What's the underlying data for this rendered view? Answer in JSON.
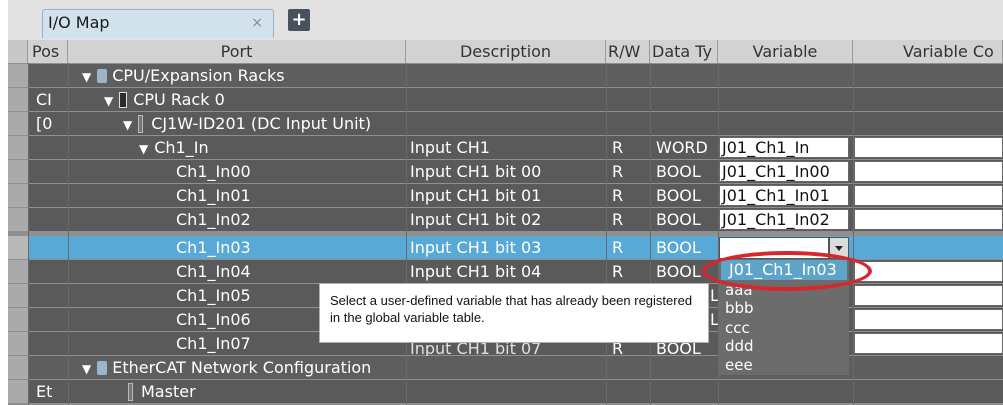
{
  "tab": {
    "title": "I/O Map",
    "close": "×",
    "add": "+"
  },
  "columns": [
    "Pos",
    "Port",
    "Description",
    "R/W",
    "Data Ty",
    "Variable",
    "Variable Co"
  ],
  "rows": [
    {
      "pos": "",
      "port": "CPU/Expansion Racks",
      "desc": "",
      "rw": "",
      "type": "",
      "var": ""
    },
    {
      "pos": "CI",
      "port": "CPU Rack 0",
      "desc": "",
      "rw": "",
      "type": "",
      "var": ""
    },
    {
      "pos": "[0",
      "port": "CJ1W-ID201 (DC Input Unit)",
      "desc": "",
      "rw": "",
      "type": "",
      "var": ""
    },
    {
      "pos": "",
      "port": "Ch1_In",
      "desc": "Input CH1",
      "rw": "R",
      "type": "WORD",
      "var": "J01_Ch1_In"
    },
    {
      "pos": "",
      "port": "Ch1_In00",
      "desc": "Input CH1 bit 00",
      "rw": "R",
      "type": "BOOL",
      "var": "J01_Ch1_In00"
    },
    {
      "pos": "",
      "port": "Ch1_In01",
      "desc": "Input CH1 bit 01",
      "rw": "R",
      "type": "BOOL",
      "var": "J01_Ch1_In01"
    },
    {
      "pos": "",
      "port": "Ch1_In02",
      "desc": "Input CH1 bit 02",
      "rw": "R",
      "type": "BOOL",
      "var": "J01_Ch1_In02"
    },
    {
      "pos": "",
      "port": "Ch1_In03",
      "desc": "Input CH1 bit 03",
      "rw": "R",
      "type": "BOOL",
      "var": ""
    },
    {
      "pos": "",
      "port": "Ch1_In04",
      "desc": "Input CH1 bit 04",
      "rw": "R",
      "type": "BOOL",
      "var": ""
    },
    {
      "pos": "",
      "port": "Ch1_In05",
      "desc": "",
      "rw": "",
      "type": "L",
      "var": ""
    },
    {
      "pos": "",
      "port": "Ch1_In06",
      "desc": "",
      "rw": "",
      "type": "L",
      "var": ""
    },
    {
      "pos": "",
      "port": "Ch1_In07",
      "desc": "Input CH1 bit 07",
      "rw": "R",
      "type": "BOOL",
      "var": ""
    },
    {
      "pos": "",
      "port": "EtherCAT Network Configuration",
      "desc": "",
      "rw": "",
      "type": "",
      "var": ""
    },
    {
      "pos": "Et",
      "port": "Master",
      "desc": "",
      "rw": "",
      "type": "",
      "var": ""
    }
  ],
  "dropdown": {
    "items": [
      "J01_Ch1_In03",
      "aaa",
      "bbb",
      "ccc",
      "ddd",
      "eee"
    ],
    "highlight_color": "#5ea4c9"
  },
  "callout": {
    "text": "Select a user-defined variable that has already been registered in the global variable table."
  },
  "colors": {
    "selected_row": "#58a9d6",
    "ring": "#d7262e"
  }
}
